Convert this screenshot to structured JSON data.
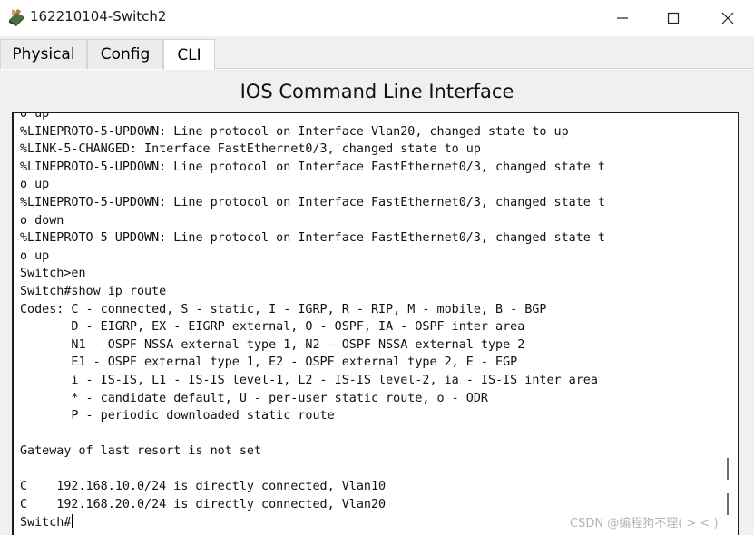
{
  "window": {
    "title": "162210104-Switch2",
    "icon": "switch-device-icon"
  },
  "tabs": [
    {
      "label": "Physical",
      "active": false
    },
    {
      "label": "Config",
      "active": false
    },
    {
      "label": "CLI",
      "active": true
    }
  ],
  "cli": {
    "heading": "IOS Command Line Interface",
    "lines": [
      "o up",
      "%LINEPROTO-5-UPDOWN: Line protocol on Interface Vlan20, changed state to up",
      "%LINK-5-CHANGED: Interface FastEthernet0/3, changed state to up",
      "%LINEPROTO-5-UPDOWN: Line protocol on Interface FastEthernet0/3, changed state t",
      "o up",
      "%LINEPROTO-5-UPDOWN: Line protocol on Interface FastEthernet0/3, changed state t",
      "o down",
      "%LINEPROTO-5-UPDOWN: Line protocol on Interface FastEthernet0/3, changed state t",
      "o up",
      "Switch>en",
      "Switch#show ip route",
      "Codes: C - connected, S - static, I - IGRP, R - RIP, M - mobile, B - BGP",
      "       D - EIGRP, EX - EIGRP external, O - OSPF, IA - OSPF inter area",
      "       N1 - OSPF NSSA external type 1, N2 - OSPF NSSA external type 2",
      "       E1 - OSPF external type 1, E2 - OSPF external type 2, E - EGP",
      "       i - IS-IS, L1 - IS-IS level-1, L2 - IS-IS level-2, ia - IS-IS inter area",
      "       * - candidate default, U - per-user static route, o - ODR",
      "       P - periodic downloaded static route",
      "",
      "Gateway of last resort is not set",
      "",
      "C    192.168.10.0/24 is directly connected, Vlan10",
      "C    192.168.20.0/24 is directly connected, Vlan20",
      "Switch#"
    ]
  },
  "watermark": "CSDN @编程狗不理( > < )"
}
